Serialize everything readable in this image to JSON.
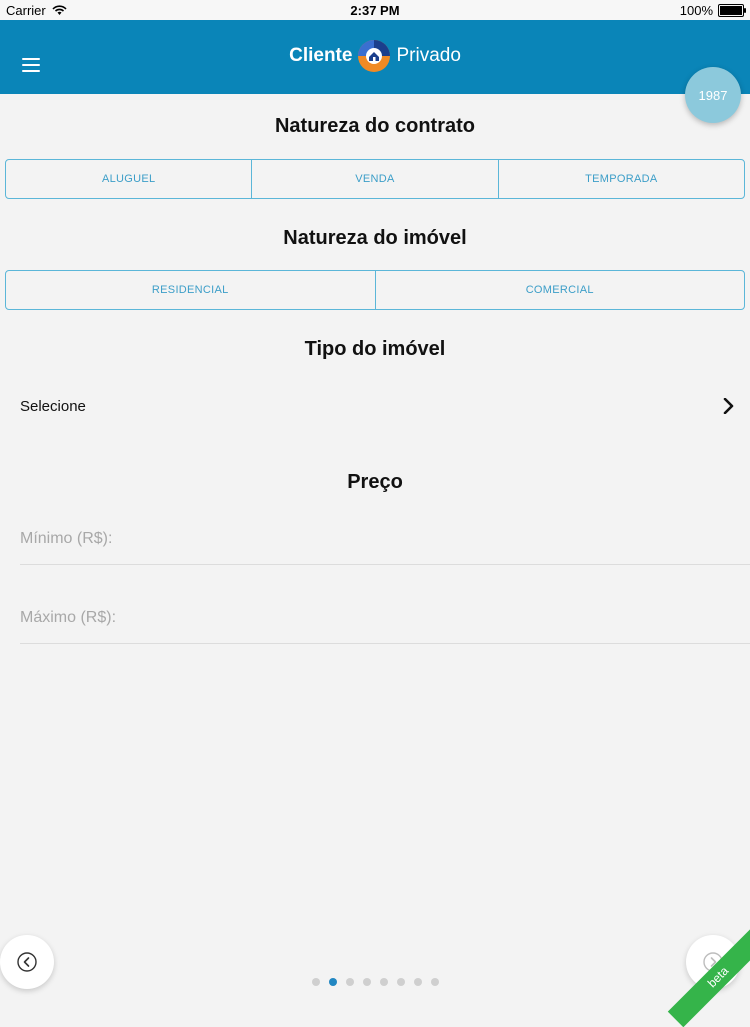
{
  "statusbar": {
    "carrier": "Carrier",
    "time": "2:37 PM",
    "battery": "100%"
  },
  "header": {
    "brand_left": "Cliente",
    "brand_right": "Privado",
    "year": "1987",
    "accent_color": "#0a85b8"
  },
  "contract": {
    "title": "Natureza do contrato",
    "options": [
      "ALUGUEL",
      "VENDA",
      "TEMPORADA"
    ]
  },
  "property": {
    "title": "Natureza do imóvel",
    "options": [
      "RESIDENCIAL",
      "COMERCIAL"
    ]
  },
  "type": {
    "title": "Tipo do imóvel",
    "select_value": "Selecione"
  },
  "price": {
    "title": "Preço",
    "min_placeholder": "Mínimo (R$):",
    "max_placeholder": "Máximo (R$):"
  },
  "pagination": {
    "count": 8,
    "active_index": 1
  },
  "ribbon": {
    "label": "beta"
  },
  "icons": {
    "menu": "hamburger-menu-icon",
    "chevron": "chevron-right-icon",
    "back": "circle-arrow-left-icon",
    "forward": "circle-arrow-right-icon"
  }
}
